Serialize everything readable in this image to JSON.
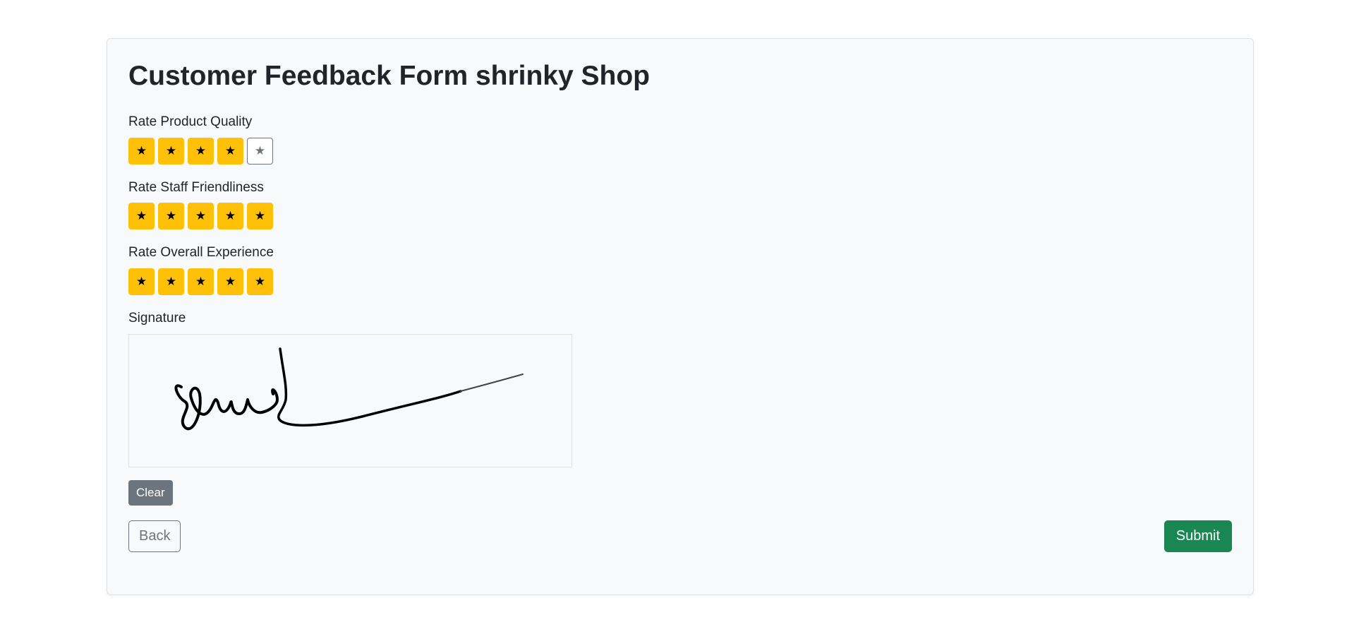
{
  "form": {
    "title": "Customer Feedback Form shrinky Shop",
    "star_glyph": "★",
    "ratings": [
      {
        "label": "Rate Product Quality",
        "value": 4,
        "max": 5
      },
      {
        "label": "Rate Staff Friendliness",
        "value": 5,
        "max": 5
      },
      {
        "label": "Rate Overall Experience",
        "value": 5,
        "max": 5
      }
    ],
    "signature_label": "Signature",
    "clear_label": "Clear",
    "back_label": "Back",
    "submit_label": "Submit"
  },
  "colors": {
    "star_filled": "#ffc107",
    "star_empty_border": "#6c757d",
    "submit": "#198754",
    "clear": "#6c757d"
  }
}
